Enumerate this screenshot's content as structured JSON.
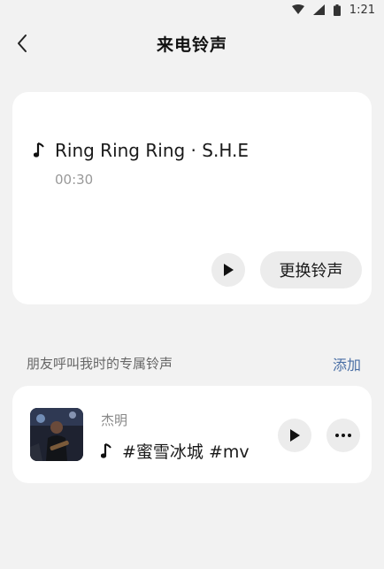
{
  "status_bar": {
    "time": "1:21"
  },
  "header": {
    "title": "来电铃声"
  },
  "current_ringtone": {
    "song_title": "Ring Ring Ring · S.H.E",
    "duration": "00:30",
    "change_button_label": "更换铃声"
  },
  "friend_section": {
    "label": "朋友呼叫我时的专属铃声",
    "add_label": "添加",
    "items": [
      {
        "friend_name": "杰明",
        "song_title": "#蜜雪冰城 #mv"
      }
    ]
  }
}
